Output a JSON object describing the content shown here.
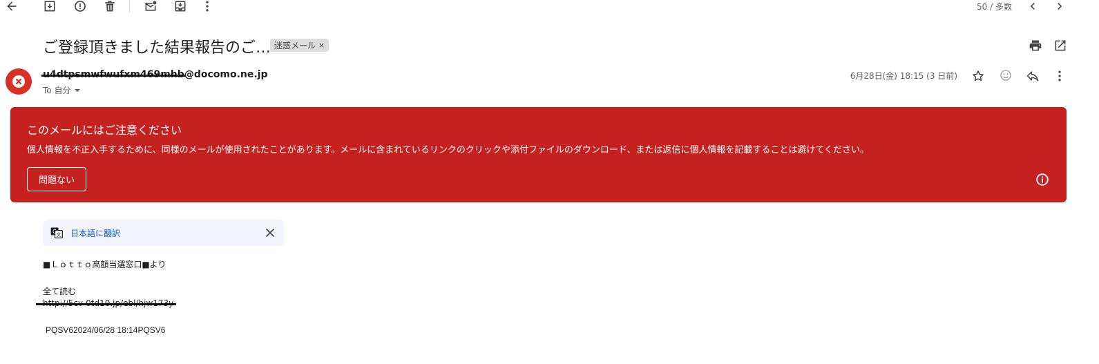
{
  "toolbar": {
    "page_count": "50 / 多数"
  },
  "message": {
    "subject": "ご登録頂きました結果報告のご…",
    "label": "迷惑メール",
    "sender_email": "u4dtpsmwfwufxm469mhb@docomo.ne.jp",
    "sender_redacted": "u4dtpsmwfwufxm469mhb",
    "sender_domain": "@docomo.ne.jp",
    "to_line": "To 自分",
    "date": "6月28日(金) 18:15 (3 日前)"
  },
  "warning": {
    "title": "このメールにはご注意ください",
    "body": "個人情報を不正入手するために、同様のメールが使用されたことがあります。メールに含まれているリンクのクリックや添付ファイルのダウンロード、または返信に個人情報を記載することは避けてください。",
    "ok_button": "問題ない",
    "color": "#c5221f"
  },
  "translate": {
    "link": "日本語に翻訳"
  },
  "body": {
    "line1": "■Ｌｏｔｔｏ高額当選窓口■より",
    "line2": "全て読む",
    "link": "http://5cv-0td10.jp/ebl/hjw173y",
    "footer": "PQSV62024/06/28 18:14PQSV6"
  }
}
